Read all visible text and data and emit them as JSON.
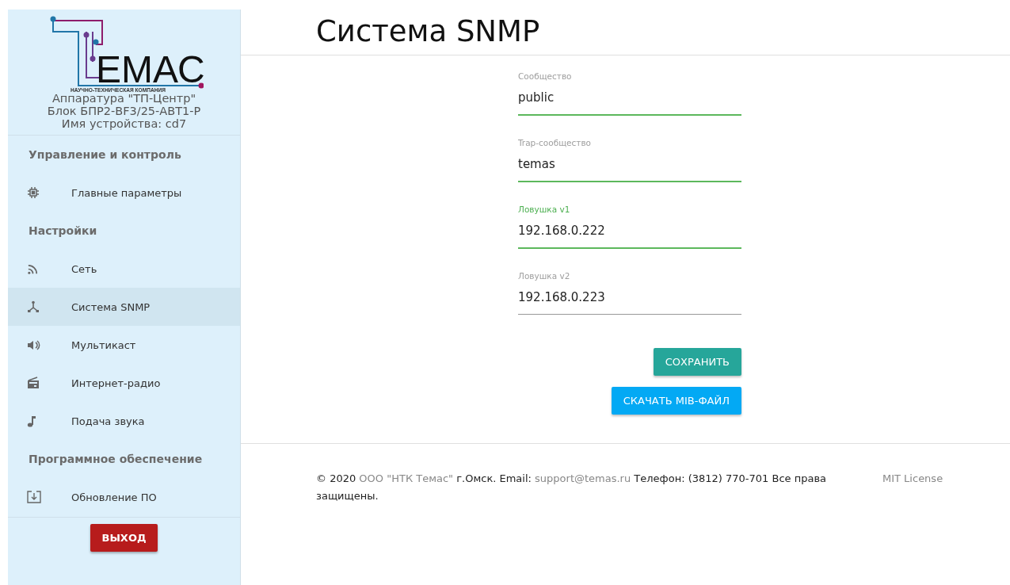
{
  "sidebar": {
    "logo": {
      "letters": "ЕМАС",
      "tagline": "НАУЧНО-ТЕХНИЧЕСКАЯ КОМПАНИЯ"
    },
    "device_lines": [
      "Аппаратура \"ТП-Центр\"",
      "Блок БПР2-BF3/25-АВТ1-Р",
      "Имя устройства: cd7"
    ],
    "nav": [
      {
        "kind": "header",
        "label": "Управление и контроль"
      },
      {
        "kind": "item",
        "label": "Главные параметры",
        "selected": false
      },
      {
        "kind": "header",
        "label": "Настройки"
      },
      {
        "kind": "item",
        "label": "Сеть",
        "selected": false
      },
      {
        "kind": "item",
        "label": "Система SNMP",
        "selected": true
      },
      {
        "kind": "item",
        "label": "Мультикаст",
        "selected": false
      },
      {
        "kind": "item",
        "label": "Интернет-радио",
        "selected": false
      },
      {
        "kind": "item",
        "label": "Подача звука",
        "selected": false
      },
      {
        "kind": "header",
        "label": "Программное обеспечение"
      },
      {
        "kind": "item",
        "label": "Обновление ПО",
        "selected": false
      }
    ],
    "logout_button": "ВЫХОД"
  },
  "page_title": "Система SNMP",
  "fields": [
    {
      "label": "Сообщество",
      "value": "public",
      "focused": false,
      "valid": true
    },
    {
      "label": "Trap-сообщество",
      "value": "temas",
      "focused": false,
      "valid": true
    },
    {
      "label": "Ловушка v1",
      "value": "192.168.0.222",
      "focused": true,
      "valid": true
    },
    {
      "label": "Ловушка v2",
      "value": "192.168.0.223",
      "focused": false,
      "valid": false
    }
  ],
  "buttons": [
    {
      "kind": "save",
      "label": "СОХРАНИТЬ"
    },
    {
      "kind": "download",
      "label": "СКАЧАТЬ MIB-ФАЙЛ"
    }
  ],
  "footer": {
    "parts": [
      {
        "kind": "text",
        "text": "© 2020 "
      },
      {
        "kind": "link",
        "text": "ООО \"НТК Темас\""
      },
      {
        "kind": "text",
        "text": " г.Омск. Email: "
      },
      {
        "kind": "link",
        "text": "support@temas.ru"
      },
      {
        "kind": "text",
        "text": " Телефон: (3812) 770-701 Все права защищены."
      }
    ],
    "license": "MIT License"
  }
}
